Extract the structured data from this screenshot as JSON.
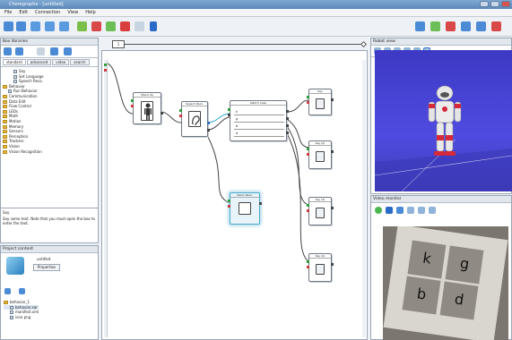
{
  "window": {
    "title": "Choregraphe - [untitled]"
  },
  "menubar": [
    "File",
    "Edit",
    "Connection",
    "View",
    "Help"
  ],
  "box_library": {
    "title": "Box libraries",
    "tabs": [
      "standard",
      "advanced",
      "video",
      "search"
    ],
    "items": [
      {
        "label": "Say",
        "type": "box",
        "indent": 2
      },
      {
        "label": "Set Language",
        "type": "box",
        "indent": 2
      },
      {
        "label": "Speech Reco.",
        "type": "box",
        "indent": 2
      },
      {
        "label": "Behavior",
        "type": "folder",
        "indent": 0
      },
      {
        "label": "Run Behavior",
        "type": "box",
        "indent": 1
      },
      {
        "label": "Communication",
        "type": "folder",
        "indent": 0
      },
      {
        "label": "Data Edit",
        "type": "folder",
        "indent": 0
      },
      {
        "label": "Flow Control",
        "type": "folder",
        "indent": 0
      },
      {
        "label": "LEDs",
        "type": "folder",
        "indent": 0
      },
      {
        "label": "Math",
        "type": "folder",
        "indent": 0
      },
      {
        "label": "Motion",
        "type": "folder",
        "indent": 0
      },
      {
        "label": "Memory",
        "type": "folder",
        "indent": 0
      },
      {
        "label": "Sensors",
        "type": "folder",
        "indent": 0
      },
      {
        "label": "Perception",
        "type": "folder",
        "indent": 0
      },
      {
        "label": "Trackers",
        "type": "folder",
        "indent": 0
      },
      {
        "label": "Vision",
        "type": "folder",
        "indent": 0
      },
      {
        "label": "Vision Recognition",
        "type": "folder",
        "indent": 0
      }
    ],
    "description_title": "Say",
    "description": "Say some text. Note that you must open the box to enter the text."
  },
  "project_content": {
    "title": "Project content",
    "object_label": "untitled",
    "properties_button": "Properties",
    "files": [
      "behavior_1",
      "behavior.xar",
      "manifest.xml",
      "icon.png"
    ]
  },
  "timeline": {
    "marker": "1"
  },
  "boxes": [
    {
      "id": "body",
      "title": "Stand Up"
    },
    {
      "id": "ear",
      "title": "Speech Reco."
    },
    {
      "id": "switch",
      "title": "Switch Case",
      "rows": [
        "k",
        "g",
        "b",
        "d"
      ]
    },
    {
      "id": "out1",
      "title": "Say"
    },
    {
      "id": "out2",
      "title": "Say (2)"
    },
    {
      "id": "out3",
      "title": "Say (3)"
    },
    {
      "id": "out4",
      "title": "Say (4)"
    },
    {
      "id": "video",
      "title": "Vision Reco."
    }
  ],
  "robot_view": {
    "title": "Robot view"
  },
  "video_monitor": {
    "title": "Video monitor",
    "cards": [
      "k",
      "g",
      "b",
      "d"
    ]
  },
  "colors": {
    "accent": "#2a6bc7",
    "robot_bg": "#4845d6",
    "selection": "#bde0ee"
  }
}
